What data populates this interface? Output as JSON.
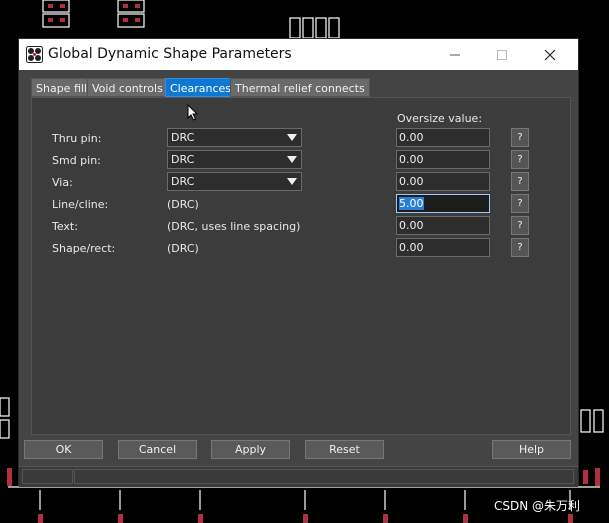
{
  "window": {
    "title": "Global Dynamic Shape Parameters",
    "minimize_icon": "minimize-icon",
    "maximize_icon": "maximize-icon",
    "close_icon": "close-icon"
  },
  "tabs": [
    {
      "label": "Shape fill",
      "active": false
    },
    {
      "label": "Void controls",
      "active": false
    },
    {
      "label": "Clearances",
      "active": true
    },
    {
      "label": "Thermal relief connects",
      "active": false
    }
  ],
  "clearances": {
    "oversize_header": "Oversize value:",
    "rows": [
      {
        "label": "Thru pin:",
        "mode": "DRC",
        "mode_type": "dropdown",
        "oversize": "0.00",
        "help": "?"
      },
      {
        "label": "Smd pin:",
        "mode": "DRC",
        "mode_type": "dropdown",
        "oversize": "0.00",
        "help": "?"
      },
      {
        "label": "Via:",
        "mode": "DRC",
        "mode_type": "dropdown",
        "oversize": "0.00",
        "help": "?"
      },
      {
        "label": "Line/cline:",
        "mode": "(DRC)",
        "mode_type": "text",
        "oversize": "5.00",
        "help": "?",
        "focused": true
      },
      {
        "label": "Text:",
        "mode": "(DRC, uses line spacing)",
        "mode_type": "text",
        "oversize": "0.00",
        "help": "?"
      },
      {
        "label": "Shape/rect:",
        "mode": "(DRC)",
        "mode_type": "text",
        "oversize": "0.00",
        "help": "?"
      }
    ]
  },
  "buttons": {
    "ok": "OK",
    "cancel": "Cancel",
    "apply": "Apply",
    "reset": "Reset",
    "help": "Help"
  },
  "watermark": "CSDN @朱万利",
  "colors": {
    "dialog_bg": "#444444",
    "panel_bg": "#3c3c3c",
    "active_tab": "#0f78d4",
    "pcb_pad": "#b03040"
  }
}
